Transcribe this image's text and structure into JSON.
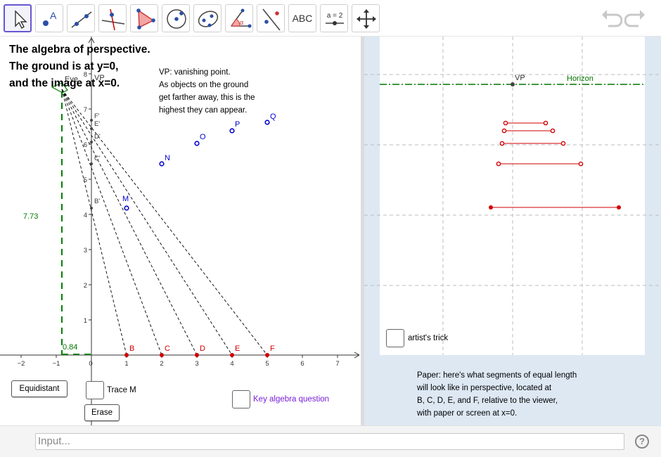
{
  "toolbar": {
    "tools": [
      {
        "name": "Move",
        "icon": "move-arrow-icon"
      },
      {
        "name": "Point",
        "icon": "point-icon",
        "letter": "A"
      },
      {
        "name": "Line",
        "icon": "line-icon"
      },
      {
        "name": "Perpendicular Line",
        "icon": "perpendicular-line-icon"
      },
      {
        "name": "Polygon",
        "icon": "polygon-icon"
      },
      {
        "name": "Circle with Center",
        "icon": "circle-icon"
      },
      {
        "name": "Ellipse",
        "icon": "ellipse-icon"
      },
      {
        "name": "Angle",
        "icon": "angle-icon",
        "letter": "α"
      },
      {
        "name": "Reflect about Line",
        "icon": "reflect-icon"
      },
      {
        "name": "Text",
        "icon": "text-icon",
        "label": "ABC"
      },
      {
        "name": "Slider",
        "icon": "slider-icon",
        "label": "a = 2"
      },
      {
        "name": "Move Graphics View",
        "icon": "move-view-icon"
      }
    ],
    "undo_icon": "undo-icon",
    "redo_icon": "redo-icon"
  },
  "view1": {
    "title_lines": [
      "The algebra of perspective.",
      "The ground is at y=0,",
      "and the image at x=0."
    ],
    "vp_text_lines": [
      "VP: vanishing point.",
      "As objects on the ground",
      "get farther away, this is the",
      "highest they can appear."
    ],
    "eye_label": "Eye",
    "vp_label": "VP",
    "height_value": "7.73",
    "offset_value": "0.84",
    "x_ticks": [
      "−2",
      "−1",
      "0",
      "1",
      "2",
      "3",
      "4",
      "5",
      "6",
      "7"
    ],
    "y_ticks": [
      "1",
      "2",
      "3",
      "4",
      "5",
      "6",
      "7",
      "8"
    ],
    "ground_points": [
      "B",
      "C",
      "D",
      "E",
      "F"
    ],
    "image_points": [
      "B'",
      "C'",
      "D'",
      "E'",
      "F'"
    ],
    "blue_points": [
      "M",
      "N",
      "O",
      "P",
      "Q"
    ],
    "equidistant_label": "Equidistant",
    "trace_label": "Trace M",
    "erase_label": "Erase",
    "key_question_label": "Key algebra question"
  },
  "view2": {
    "vp_label": "VP",
    "horizon_label": "Horizon",
    "artist_trick_label": "artist's trick",
    "paper_lines": [
      "Paper: here's what segments of equal length",
      "will look like in perspective, located at",
      "B, C, D, E, and F, relative to the viewer,",
      "with paper or screen at x=0."
    ]
  },
  "input": {
    "placeholder": "Input..."
  },
  "help_label": "?",
  "colors": {
    "accent": "#6557d2",
    "ground_red": "#d00000",
    "point_blue": "#0000cc",
    "horizon_green": "#007700",
    "dashed_green": "#008000",
    "key_question_purple": "#7a1fd6"
  }
}
